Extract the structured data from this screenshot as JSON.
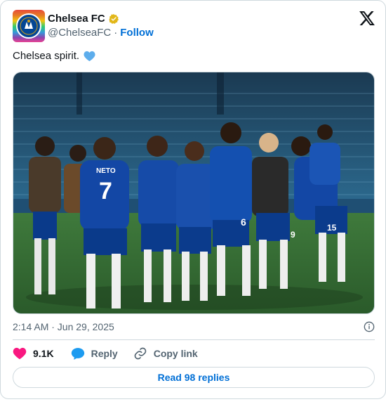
{
  "author": {
    "display_name": "Chelsea FC",
    "handle": "@ChelseaFC",
    "separator": "·",
    "follow_label": "Follow",
    "verified_badge_color": "#e2b719"
  },
  "tweet": {
    "text": "Chelsea spirit.",
    "emoji": "blue-heart-icon",
    "timestamp": "2:14 AM · Jun 29, 2025"
  },
  "media": {
    "description_icon": "team-celebration-photo"
  },
  "actions": {
    "likes_count": "9.1K",
    "reply_label": "Reply",
    "copy_link_label": "Copy link"
  },
  "footer": {
    "read_replies_label": "Read 98 replies"
  },
  "colors": {
    "link_blue": "#006fd6",
    "heart_red": "#f91880",
    "reply_blue": "#1d9bf0",
    "border": "#cfd9de",
    "secondary_text": "#536471"
  }
}
